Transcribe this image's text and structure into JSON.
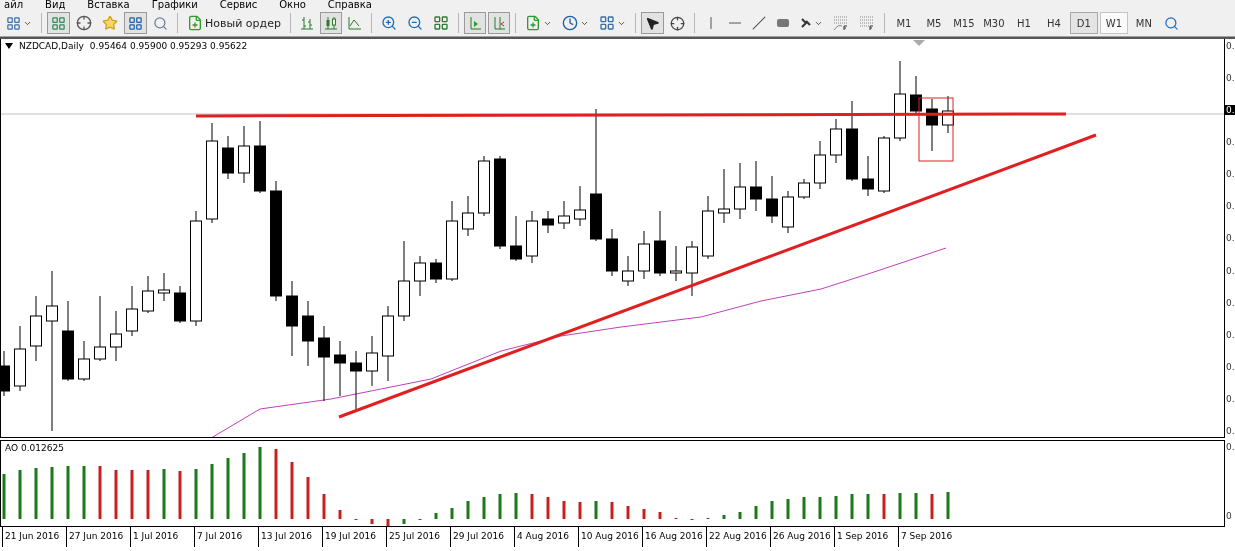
{
  "menu": [
    "айл",
    "Вид",
    "Вставка",
    "Графики",
    "Сервис",
    "Окно",
    "Справка"
  ],
  "toolbar": {
    "new_order": "Новый ордер",
    "timeframes": [
      {
        "label": "M1",
        "selected": false,
        "highlighted": false
      },
      {
        "label": "M5",
        "selected": false,
        "highlighted": false
      },
      {
        "label": "M15",
        "selected": false,
        "highlighted": false
      },
      {
        "label": "M30",
        "selected": false,
        "highlighted": false
      },
      {
        "label": "H1",
        "selected": false,
        "highlighted": false
      },
      {
        "label": "H4",
        "selected": false,
        "highlighted": false
      },
      {
        "label": "D1",
        "selected": true,
        "highlighted": false
      },
      {
        "label": "W1",
        "selected": false,
        "highlighted": true
      },
      {
        "label": "MN",
        "selected": false,
        "highlighted": false
      }
    ]
  },
  "chart": {
    "symbol": "NZDCAD,Daily",
    "ohlc": "0.95464 0.95900 0.95293 0.95622",
    "price_axis": [
      {
        "label": "0.",
        "kind": "tick"
      },
      {
        "label": "0.",
        "kind": "tick"
      },
      {
        "label": "0.",
        "kind": "current"
      },
      {
        "label": "0.",
        "kind": "tick"
      },
      {
        "label": "0.",
        "kind": "tick"
      },
      {
        "label": "0.",
        "kind": "tick"
      },
      {
        "label": "0.",
        "kind": "tick"
      },
      {
        "label": "0.",
        "kind": "tick"
      },
      {
        "label": "0.",
        "kind": "tick"
      },
      {
        "label": "0.",
        "kind": "tick"
      },
      {
        "label": "0.",
        "kind": "tick"
      },
      {
        "label": "0.",
        "kind": "tick"
      },
      {
        "label": "0.",
        "kind": "tick"
      }
    ],
    "indicator": {
      "label": "AO 0.012625",
      "axis": [
        "0.",
        "0"
      ]
    },
    "dates": [
      "21 Jun 2016",
      "27 Jun 2016",
      "1 Jul 2016",
      "7 Jul 2016",
      "13 Jul 2016",
      "19 Jul 2016",
      "25 Jul 2016",
      "29 Jul 2016",
      "4 Aug 2016",
      "10 Aug 2016",
      "16 Aug 2016",
      "22 Aug 2016",
      "26 Aug 2016",
      "1 Sep 2016",
      "7 Sep 2016"
    ]
  }
}
